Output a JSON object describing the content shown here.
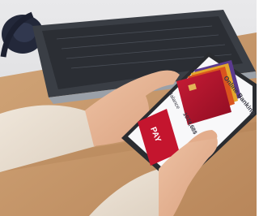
{
  "photo": {
    "subject": "hands holding smartphone with banking app in front of laptop",
    "colors": {
      "desk": "#c89a6c",
      "laptop": "#3a3e45",
      "sweater": "#e9ddcf",
      "skin": "#e7b596",
      "phone_frame": "#2a2c30",
      "screen": "#f8f8fa",
      "card_red": "#a8112a",
      "card_orange": "#d9541e",
      "card_yellow": "#e3a72b",
      "card_purple": "#5b3a8e",
      "pay_button": "#c4152e"
    }
  },
  "app": {
    "title": "Online Banking",
    "balance_label": "Balance",
    "balance_value": "1074,68$",
    "pay_label": "PAY"
  }
}
